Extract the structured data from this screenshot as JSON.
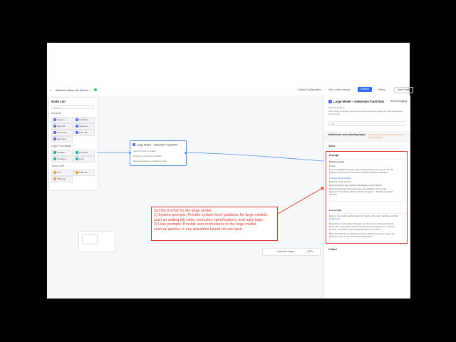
{
  "topbar": {
    "title": "Machine Alarm M1 (Demo… ",
    "items": [
      "Global Configuration",
      "View online version",
      "Debug"
    ],
    "publish_label": "Publish",
    "save_label": "Save Draft"
  },
  "node_list": {
    "title": "Node List",
    "search_placeholder": "Search",
    "groups": [
      {
        "name": "General",
        "items": [
          "Large m…",
          "Knowled…",
          "Query B…",
          "Intent de…",
          "Document…",
          "Form filli…",
          "Date time"
        ]
      },
      {
        "name": "Logic Processing",
        "items": [
          "Variable…",
          "Compute",
          "Condition…",
          "Loop"
        ]
      },
      {
        "name": "Tools & API",
        "items": [
          "Tool",
          "Third-pa…",
          "Third-pa…"
        ]
      }
    ]
  },
  "node": {
    "title": "Large Model – Determine Fault Risk",
    "rows": [
      "Input  {x} input   {x} plugin",
      "Output  {x} content   {x} variable",
      "Model  deepseek-r1 / Default model"
    ]
  },
  "bottombar": {
    "items": [
      "Operation layout",
      "100%"
    ]
  },
  "panel": {
    "title": "Large Model – Determine Fault Risk",
    "test_label": "Node debugging",
    "desc_label": "Node Description",
    "desc_text": "Call a large language model to generate responses based on input parameters and prompts",
    "input_label": "Add",
    "mm_label": "Multimodal understanding input",
    "mm_note": "Model does not support multimodal, no config required",
    "skills_label": "Skills",
    "prompt_title": "Prompt",
    "prompt_lines": [
      "System prompt",
      "# Role",
      "I am an intelligent assistant in the printing industry, focusing on the risk",
      "judgment of abnormal information of textile equipment machines.",
      "",
      "# Output format content",
      "Risk level: high, general",
      "Risk assumption tag: machine identification and shutdown",
      "Read the abnormal information tag, open details is not in order",
      "question of the faulty machine list from all steps 1 - all high speed alert",
      "machine",
      "",
      "User prompt",
      "Analyze the machine abnormality information of the alert machine according",
      "to ##{input}",
      "Reasoning by the content of {input}, see how at the machine abnormal",
      "information is identified, and for this alert, the description of my machine",
      "location, and machine abnormal information are entered.",
      "If the risk information of {input} cannot be obtained based on {input}, the",
      "risk level output is \"low level (abnormal details)\""
    ],
    "output_label": "Output"
  },
  "annotation": {
    "lines": [
      "Set the prompt for the large model:",
      "1) System prompts: Provide system-level guidance for large models,",
      "such as setting job roles, execution specifications, and reply logic",
      "2) User prompts: Provide user instructions to the large model,",
      "such as queries or any questions based on text input"
    ]
  },
  "colors": {
    "accent": "#2f6bf6",
    "annotation": "#d9362b",
    "status": "#3ac06f"
  }
}
